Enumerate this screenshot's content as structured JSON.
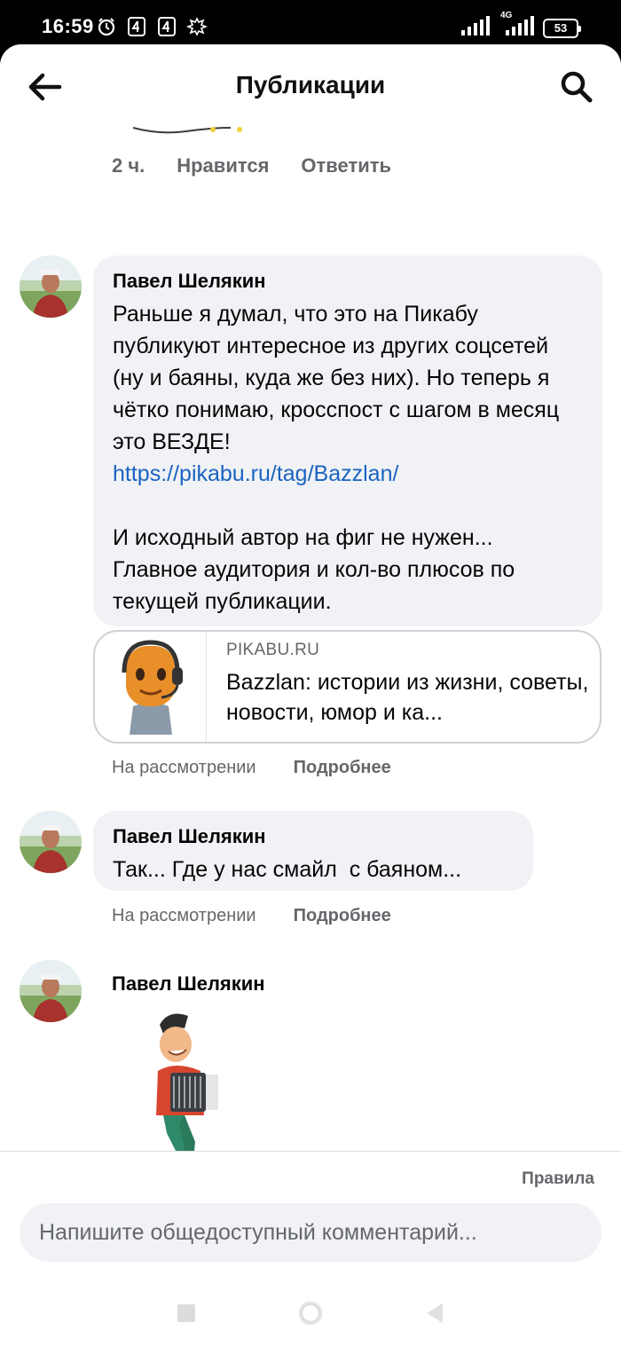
{
  "status_bar": {
    "time": "16:59",
    "battery": "53",
    "network": "4G"
  },
  "header": {
    "title": "Публикации",
    "back_icon": "arrow-left-icon",
    "search_icon": "search-icon"
  },
  "top_comment_meta": {
    "time": "2 ч.",
    "like": "Нравится",
    "reply": "Ответить"
  },
  "comments": [
    {
      "author": "Павел Шелякин",
      "text_before_link": "Раньше я думал, что это на Пикабу публикуют интересное из других соцсетей (ну и баяны, куда же без них). Но теперь я чётко понимаю, кросспост с шагом в месяц это ВЕЗДЕ!",
      "link": "https://pikabu.ru/tag/Bazzlan/",
      "text_after_link": "И исходный автор на фиг не нужен... Главное аудитория и кол-во плюсов по текущей публикации.",
      "card": {
        "domain": "PIKABU.RU",
        "title": "Bazzlan: истории из жизни, советы, новости, юмор и ка..."
      },
      "status": "На рассмотрении",
      "more": "Подробнее"
    },
    {
      "author": "Павел Шелякин",
      "text": "Так... Где у нас смайл  с баяном...",
      "status": "На рассмотрении",
      "more": "Подробнее"
    },
    {
      "author": "Павел Шелякин",
      "sticker": "accordion-player-sticker"
    }
  ],
  "composer": {
    "rules": "Правила",
    "placeholder": "Напишите общедоступный комментарий..."
  },
  "colors": {
    "bubble": "#f0f2f5",
    "link": "#1a63c1",
    "muted": "#65676b"
  }
}
